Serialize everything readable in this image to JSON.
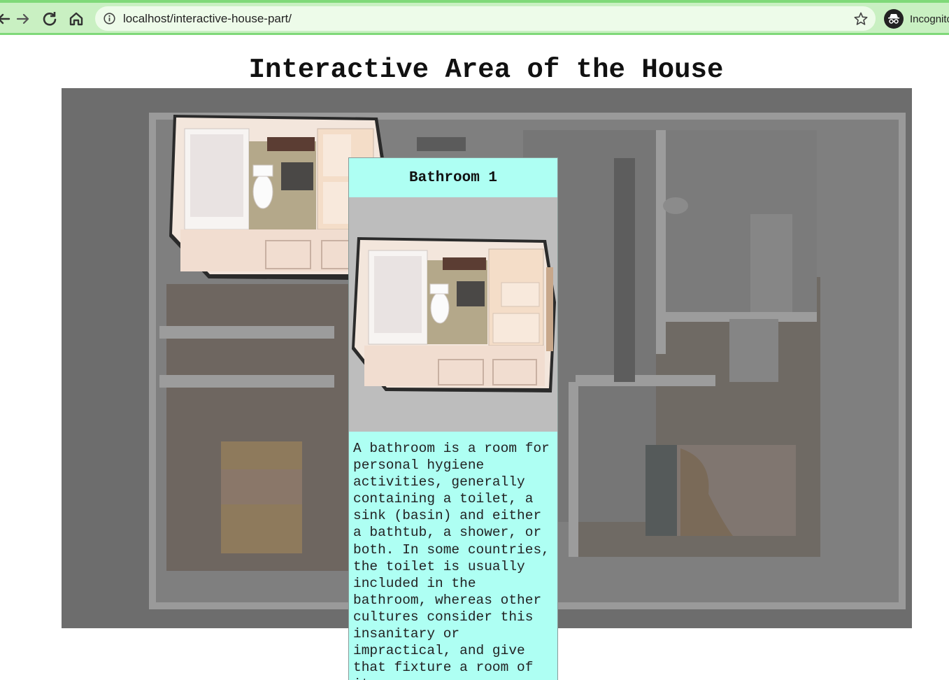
{
  "browser": {
    "url": "localhost/interactive-house-part/",
    "profile_label": "Incognito",
    "icons": [
      "back-arrow-icon",
      "forward-arrow-icon",
      "reload-icon",
      "home-icon",
      "info-icon",
      "star-icon",
      "incognito-icon"
    ]
  },
  "page": {
    "title": "Interactive Area of the House"
  },
  "popup": {
    "title": "Bathroom 1",
    "description": "A bathroom is a room for personal hygiene activities, generally containing a toilet, a sink (basin) and either a bathtub, a shower, or both. In some countries, the toilet is usually included in the bathroom, whereas other cultures consider this insanitary or impractical, and give that fixture a room of its own."
  },
  "colors": {
    "chrome_bar": "#c9f0c2",
    "chrome_border": "#7fd979",
    "popup_accent": "#aefff3",
    "plan_overlay": "#6f6f6f"
  }
}
